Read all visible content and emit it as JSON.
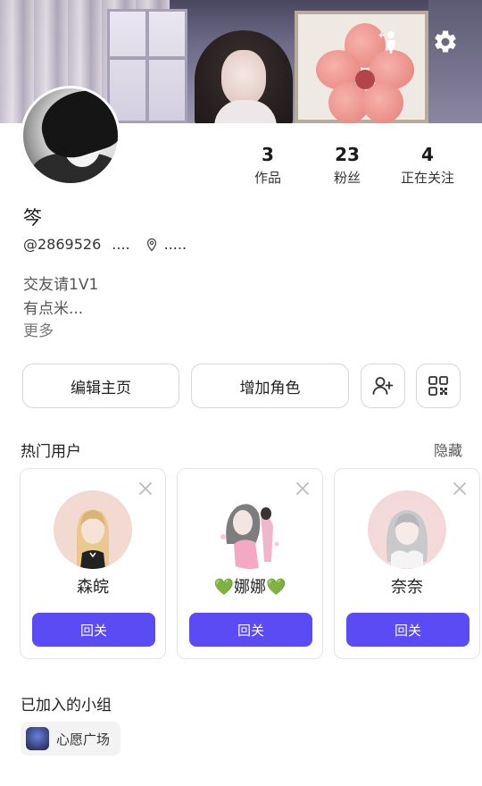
{
  "profile": {
    "name": "笒",
    "user_id": "@2869526",
    "id_suffix": "....",
    "location": ".....",
    "bio_lines": [
      "交友请1V1",
      "有点米..."
    ],
    "more_label": "更多"
  },
  "stats": [
    {
      "value": "3",
      "label": "作品"
    },
    {
      "value": "23",
      "label": "粉丝"
    },
    {
      "value": "4",
      "label": "正在关注"
    }
  ],
  "actions": {
    "edit_label": "编辑主页",
    "add_role_label": "增加角色",
    "add_friend_icon": "add-user-icon",
    "qr_icon": "qr-code-icon"
  },
  "hot_users": {
    "title": "热门用户",
    "hide_label": "隐藏",
    "users": [
      {
        "name": "森皖",
        "button": "回关"
      },
      {
        "name": "💚娜娜💚",
        "button": "回关"
      },
      {
        "name": "奈奈",
        "button": "回关"
      }
    ]
  },
  "groups": {
    "title": "已加入的小组",
    "items": [
      {
        "name": "心愿广场"
      }
    ]
  },
  "colors": {
    "accent": "#5b4bf5",
    "border": "#d6d6d6"
  }
}
